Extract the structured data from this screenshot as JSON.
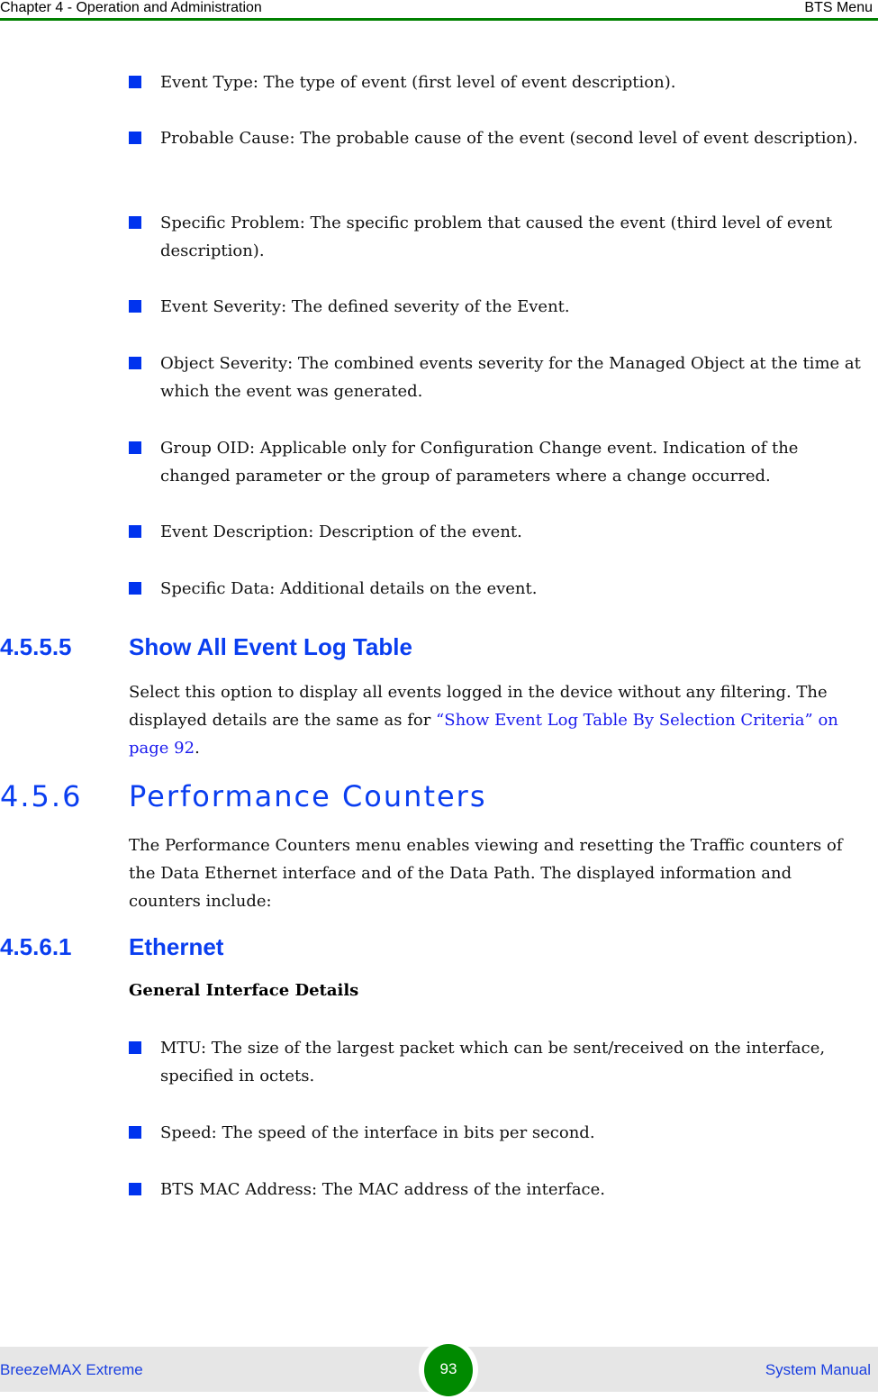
{
  "header": {
    "chapter": "Chapter 4 - Operation and Administration",
    "section": "BTS Menu",
    "rule_color": "#008000"
  },
  "event_fields": [
    {
      "text": "Event Type: The type of event (first level of event description)."
    },
    {
      "text": "Probable Cause: The probable cause of the event (second level of event description)."
    },
    {
      "text": "Specific Problem: The specific problem that caused the event (third level of event description)."
    },
    {
      "text": "Event Severity: The defined severity of the Event."
    },
    {
      "text": "Object Severity: The combined events severity for the Managed Object at the time at which the event was generated."
    },
    {
      "text": "Group OID: Applicable only for Configuration Change event. Indication of the changed parameter or the group of parameters where a change occurred."
    },
    {
      "text": "Event Description: Description of the event."
    },
    {
      "text": "Specific Data: Additional details on the event."
    }
  ],
  "section_4555": {
    "number": "4.5.5.5",
    "title": "Show All Event Log Table",
    "body_prefix": "Select this option to display all events logged in the device without any filtering. The displayed details are the same as for ",
    "link_text": "“Show Event Log Table By Selection Criteria” on page 92",
    "body_suffix": "."
  },
  "section_456": {
    "number": "4.5.6",
    "title": "Performance Counters",
    "body": "The Performance Counters menu enables viewing and resetting the Traffic counters of the Data Ethernet interface and of the Data Path. The displayed information and counters include:"
  },
  "section_4561": {
    "number": "4.5.6.1",
    "title": "Ethernet",
    "subheading": "General Interface Details",
    "items": [
      {
        "text": "MTU: The size of the largest packet which can be sent/received on the interface, specified in octets."
      },
      {
        "text": "Speed: The speed of the interface in bits per second."
      },
      {
        "text": "BTS MAC Address: The MAC address of the interface."
      }
    ]
  },
  "footer": {
    "product": "BreezeMAX Extreme",
    "page_number": "93",
    "doc_type": "System Manual"
  },
  "colors": {
    "heading_blue": "#0a3ef0",
    "bullet_blue": "#0033ee",
    "link_blue": "#1a1aee",
    "brand_green": "#008000"
  }
}
